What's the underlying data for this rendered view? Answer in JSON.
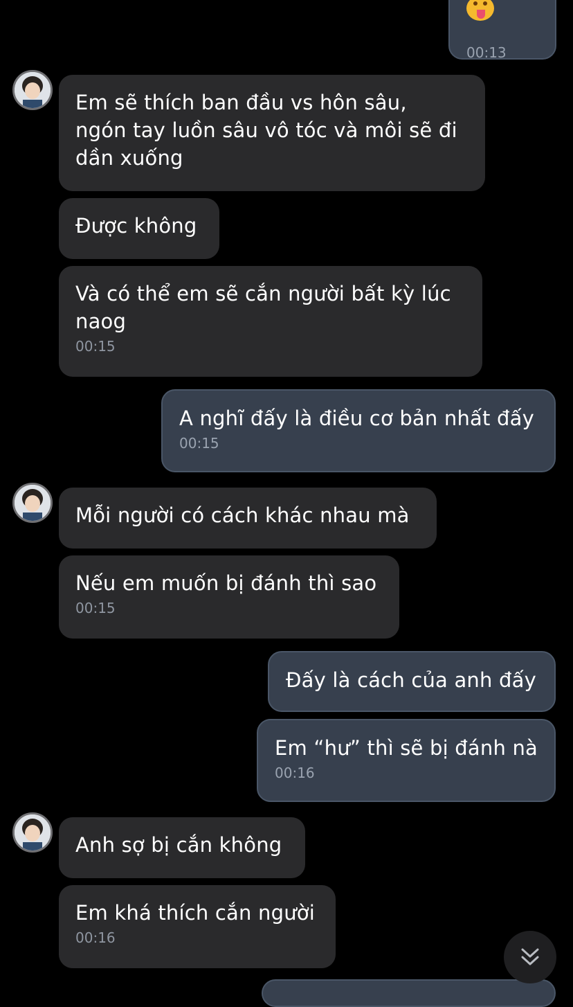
{
  "contact": {
    "avatar_icon": "avatar-photo"
  },
  "messages": [
    {
      "dir": "out",
      "text": "",
      "time": "00:13",
      "emoji": "face-with-tongue-icon"
    },
    {
      "dir": "in",
      "text": "Em sẽ thích ban đầu vs hôn sâu,\nngón tay luồn sâu vô tóc và môi sẽ đi\ndần xuống",
      "time": ""
    },
    {
      "dir": "in",
      "text": "Được không",
      "time": ""
    },
    {
      "dir": "in",
      "text": "Và có thể em sẽ cắn người bất kỳ lúc\nnaog",
      "time": "00:15"
    },
    {
      "dir": "out",
      "text": "A nghĩ đấy là điều cơ bản nhất đấy",
      "time": "00:15"
    },
    {
      "dir": "in",
      "text": "Mỗi người có cách khác nhau mà",
      "time": ""
    },
    {
      "dir": "in",
      "text": "Nếu em muốn bị đánh thì sao",
      "time": "00:15"
    },
    {
      "dir": "out",
      "text": "Đấy là cách của anh đấy",
      "time": ""
    },
    {
      "dir": "out",
      "text": "Em “hư” thì sẽ bị đánh nà",
      "time": "00:16"
    },
    {
      "dir": "in",
      "text": "Anh sợ bị cắn không",
      "time": ""
    },
    {
      "dir": "in",
      "text": "Em khá thích cắn người",
      "time": "00:16"
    }
  ],
  "scroll_button": {
    "icon": "chevron-double-down-icon"
  },
  "colors": {
    "background": "#000000",
    "incoming": "#2a2a2c",
    "outgoing": "#37404e"
  }
}
